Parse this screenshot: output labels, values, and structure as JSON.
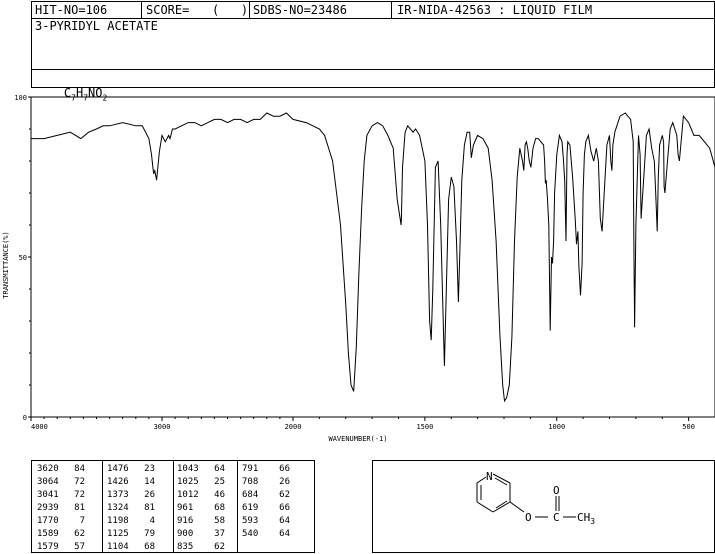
{
  "header": {
    "hit_no": "HIT-NO=106",
    "score_label": "SCORE=",
    "score_value": "(   )",
    "sdbs_no": "SDBS-NO=23486",
    "ir_info": "IR-NIDA-42563 : LIQUID FILM"
  },
  "compound": {
    "name": "3-PYRIDYL ACETATE",
    "formula": {
      "c": "C",
      "c_n": "7",
      "h": "H",
      "h_n": "7",
      "n": "N",
      "o": "O",
      "o_n": "2"
    }
  },
  "chart_data": {
    "type": "line",
    "title": "",
    "xlabel": "WAVENUMBER(-1)",
    "ylabel": "TRANSMITTANCE(%)",
    "xlim": [
      4000,
      400
    ],
    "ylim": [
      0,
      100
    ],
    "x_ticks": [
      4000,
      3000,
      2000,
      1500,
      1000,
      500
    ],
    "y_ticks": [
      0,
      50,
      100
    ],
    "grid": false,
    "series": [
      {
        "x": [
          4000,
          3900,
          3800,
          3700,
          3620,
          3560,
          3500,
          3450,
          3400,
          3300,
          3200,
          3150,
          3100,
          3080,
          3064,
          3055,
          3041,
          3020,
          3000,
          2975,
          2950,
          2939,
          2920,
          2900,
          2850,
          2800,
          2750,
          2700,
          2650,
          2600,
          2550,
          2500,
          2450,
          2400,
          2350,
          2300,
          2250,
          2200,
          2150,
          2100,
          2050,
          2000,
          1950,
          1900,
          1880,
          1850,
          1820,
          1800,
          1790,
          1780,
          1770,
          1760,
          1750,
          1740,
          1730,
          1720,
          1700,
          1680,
          1660,
          1640,
          1620,
          1605,
          1590,
          1589,
          1585,
          1575,
          1565,
          1555,
          1545,
          1535,
          1520,
          1500,
          1490,
          1482,
          1476,
          1470,
          1460,
          1450,
          1440,
          1432,
          1426,
          1418,
          1410,
          1400,
          1390,
          1380,
          1373,
          1368,
          1360,
          1350,
          1340,
          1330,
          1324,
          1316,
          1300,
          1280,
          1260,
          1245,
          1230,
          1215,
          1205,
          1198,
          1190,
          1180,
          1170,
          1160,
          1150,
          1140,
          1130,
          1125,
          1120,
          1115,
          1110,
          1104,
          1098,
          1090,
          1080,
          1070,
          1060,
          1050,
          1046,
          1043,
          1040,
          1035,
          1030,
          1025,
          1020,
          1016,
          1012,
          1008,
          1000,
          990,
          980,
          975,
          970,
          965,
          961,
          958,
          950,
          940,
          930,
          925,
          920,
          916,
          910,
          904,
          900,
          895,
          890,
          880,
          870,
          860,
          850,
          842,
          835,
          828,
          820,
          810,
          800,
          795,
          791,
          787,
          780,
          760,
          740,
          720,
          710,
          708,
          705,
          700,
          690,
          684,
          680,
          670,
          660,
          650,
          640,
          630,
          625,
          619,
          615,
          610,
          600,
          595,
          593,
          590,
          580,
          570,
          560,
          545,
          540,
          535,
          520,
          500,
          480,
          460,
          440,
          420,
          400
        ],
        "y": [
          87,
          87,
          88,
          89,
          87,
          89,
          90,
          91,
          91,
          92,
          91,
          91,
          87,
          82,
          76,
          77,
          74,
          83,
          88,
          86,
          88,
          87,
          90,
          90,
          91,
          92,
          92,
          91,
          92,
          93,
          93,
          92,
          93,
          93,
          92,
          93,
          93,
          95,
          94,
          94,
          95,
          93,
          92,
          90,
          88,
          80,
          60,
          35,
          20,
          10,
          8,
          22,
          45,
          65,
          80,
          88,
          91,
          92,
          91,
          88,
          84,
          68,
          60,
          62,
          78,
          89,
          91,
          90,
          89,
          90,
          88,
          80,
          60,
          30,
          24,
          40,
          78,
          80,
          60,
          35,
          16,
          42,
          68,
          75,
          72,
          55,
          36,
          50,
          74,
          85,
          89,
          89,
          81,
          85,
          88,
          87,
          84,
          74,
          55,
          25,
          10,
          5,
          6,
          10,
          25,
          55,
          75,
          84,
          80,
          77,
          85,
          86,
          84,
          80,
          78,
          84,
          87,
          87,
          86,
          85,
          80,
          73,
          74,
          68,
          60,
          27,
          50,
          48,
          55,
          70,
          82,
          88,
          86,
          81,
          74,
          55,
          82,
          86,
          85,
          75,
          62,
          54,
          58,
          47,
          38,
          48,
          70,
          82,
          86,
          88,
          83,
          80,
          84,
          80,
          62,
          58,
          70,
          85,
          88,
          80,
          77,
          85,
          89,
          94,
          95,
          93,
          86,
          57,
          28,
          60,
          88,
          82,
          62,
          75,
          88,
          90,
          84,
          80,
          70,
          58,
          75,
          85,
          88,
          86,
          72,
          70,
          80,
          90,
          92,
          88,
          82,
          80,
          94,
          92,
          88,
          88,
          86,
          84,
          78
        ]
      }
    ]
  },
  "peak_table": {
    "columns": [
      [
        [
          "3620",
          "84"
        ],
        [
          "3064",
          "72"
        ],
        [
          "3041",
          "72"
        ],
        [
          "2939",
          "81"
        ],
        [
          "1770",
          "7"
        ],
        [
          "1589",
          "62"
        ],
        [
          "1579",
          "57"
        ]
      ],
      [
        [
          "1476",
          "23"
        ],
        [
          "1426",
          "14"
        ],
        [
          "1373",
          "26"
        ],
        [
          "1324",
          "81"
        ],
        [
          "1198",
          "4"
        ],
        [
          "1125",
          "79"
        ],
        [
          "1104",
          "68"
        ]
      ],
      [
        [
          "1043",
          "64"
        ],
        [
          "1025",
          "25"
        ],
        [
          "1012",
          "46"
        ],
        [
          "961",
          "68"
        ],
        [
          "916",
          "58"
        ],
        [
          "900",
          "37"
        ],
        [
          "835",
          "62"
        ]
      ],
      [
        [
          "791",
          "66"
        ],
        [
          "708",
          "26"
        ],
        [
          "684",
          "62"
        ],
        [
          "619",
          "66"
        ],
        [
          "593",
          "64"
        ],
        [
          "540",
          "64"
        ]
      ]
    ]
  },
  "structure": {
    "ring_atom": "N",
    "o_atom": "O",
    "carbonyl_o": "O",
    "carbon": "C",
    "methyl": "CH",
    "methyl_sub": "3"
  }
}
